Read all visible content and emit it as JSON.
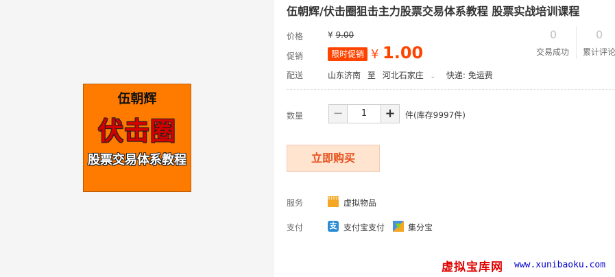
{
  "product": {
    "title": "伍朝辉/伏击圈狙击主力股票交易体系教程 股票实战培训课程",
    "image": {
      "line1": "伍朝辉",
      "line2": "伏击圈",
      "line3": "股票交易体系教程",
      "bg_color": "#ff7b00"
    }
  },
  "labels": {
    "price": "价格",
    "promo": "促销",
    "delivery": "配送",
    "quantity": "数量",
    "service": "服务",
    "payment": "支付"
  },
  "price": {
    "currency": "¥",
    "original": "9.00"
  },
  "promotion": {
    "tag": "限时促销",
    "currency": "¥",
    "price": "1.00",
    "accent": "#ff4400"
  },
  "stats": {
    "sales_count": "0",
    "sales_label": "交易成功",
    "reviews_count": "0",
    "reviews_label": "累计评论"
  },
  "shipping": {
    "from": "山东济南",
    "to_word": "至",
    "destination": "河北石家庄",
    "express": "快递: 免运费"
  },
  "quantity": {
    "minus": "−",
    "value": "1",
    "plus": "+",
    "stock_text": "件(库存9997件)"
  },
  "buy_button": "立即购买",
  "service": {
    "icon": "virtual-goods-icon",
    "icon_text": "010101",
    "text": "虚拟物品"
  },
  "payment": [
    {
      "icon": "alipay-icon",
      "icon_glyph": "支",
      "text": "支付宝支付"
    },
    {
      "icon": "jifenbao-icon",
      "text": "集分宝"
    }
  ],
  "watermark": {
    "cn": "虚拟宝库网",
    "url": "www.xunibaoku.com"
  }
}
